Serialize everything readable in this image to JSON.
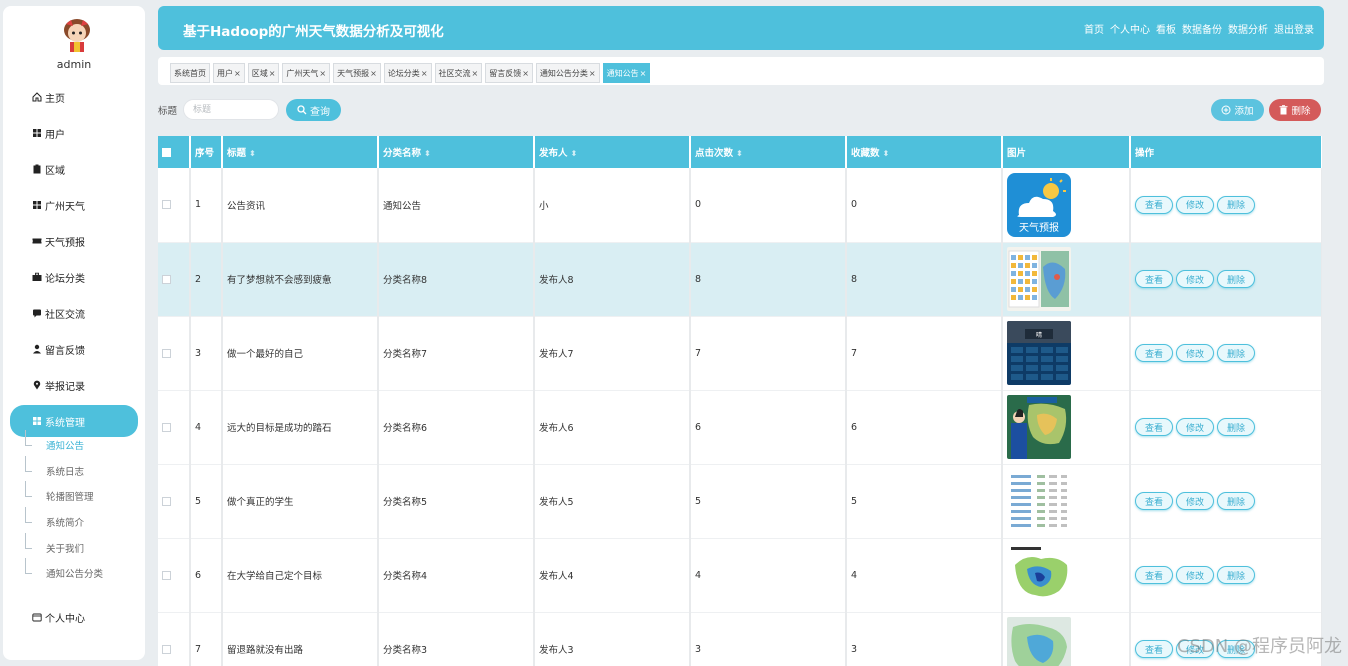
{
  "app": {
    "title": "基于Hadoop的广州天气数据分析及可视化",
    "username": "admin",
    "accent": "#4ec0dc"
  },
  "top_nav": [
    "首页",
    "个人中心",
    "看板",
    "数据备份",
    "数据分析",
    "退出登录"
  ],
  "sidebar": {
    "items": [
      {
        "label": "主页",
        "icon": "home-icon"
      },
      {
        "label": "用户",
        "icon": "grid-icon"
      },
      {
        "label": "区域",
        "icon": "clipboard-icon"
      },
      {
        "label": "广州天气",
        "icon": "grid-icon"
      },
      {
        "label": "天气预报",
        "icon": "ticket-icon"
      },
      {
        "label": "论坛分类",
        "icon": "briefcase-icon"
      },
      {
        "label": "社区交流",
        "icon": "chat-icon"
      },
      {
        "label": "留言反馈",
        "icon": "user-icon"
      },
      {
        "label": "举报记录",
        "icon": "pin-icon"
      },
      {
        "label": "系统管理",
        "icon": "grid-icon",
        "active": true
      },
      {
        "label": "个人中心",
        "icon": "wallet-icon"
      }
    ],
    "sub_items": [
      "通知公告",
      "系统日志",
      "轮播图管理",
      "系统简介",
      "关于我们",
      "通知公告分类"
    ]
  },
  "tabs": [
    "系统首页",
    "用户",
    "区域",
    "广州天气",
    "天气预报",
    "论坛分类",
    "社区交流",
    "留言反馈",
    "通知公告分类",
    "通知公告"
  ],
  "search": {
    "label": "标题",
    "placeholder": "标题",
    "button": "查询"
  },
  "actions": {
    "add": "添加",
    "delete": "删除"
  },
  "table": {
    "headers": [
      "序号",
      "标题",
      "分类名称",
      "发布人",
      "点击次数",
      "收藏数",
      "图片",
      "操作"
    ],
    "op_labels": [
      "查看",
      "修改",
      "删除"
    ],
    "rows": [
      {
        "no": "1",
        "title": "公告资讯",
        "category": "通知公告",
        "publisher": "小",
        "clicks": "0",
        "favorites": "0",
        "image": "weather-app-icon"
      },
      {
        "no": "2",
        "title": "有了梦想就不会感到疲惫",
        "category": "分类名称8",
        "publisher": "发布人8",
        "clicks": "8",
        "favorites": "8",
        "image": "weather-map-screenshot"
      },
      {
        "no": "3",
        "title": "做一个最好的自己",
        "category": "分类名称7",
        "publisher": "发布人7",
        "clicks": "7",
        "favorites": "7",
        "image": "weather-phone-screenshot"
      },
      {
        "no": "4",
        "title": "远大的目标是成功的踏石",
        "category": "分类名称6",
        "publisher": "发布人6",
        "clicks": "6",
        "favorites": "6",
        "image": "weather-broadcast-photo"
      },
      {
        "no": "5",
        "title": "做个真正的学生",
        "category": "分类名称5",
        "publisher": "发布人5",
        "clicks": "5",
        "favorites": "5",
        "image": "weather-table-screenshot"
      },
      {
        "no": "6",
        "title": "在大学给自己定个目标",
        "category": "分类名称4",
        "publisher": "发布人4",
        "clicks": "4",
        "favorites": "4",
        "image": "rain-distribution-map"
      },
      {
        "no": "7",
        "title": "留退路就没有出路",
        "category": "分类名称3",
        "publisher": "发布人3",
        "clicks": "3",
        "favorites": "3",
        "image": "weather-map"
      }
    ]
  },
  "watermark": "CSDN @程序员阿龙"
}
